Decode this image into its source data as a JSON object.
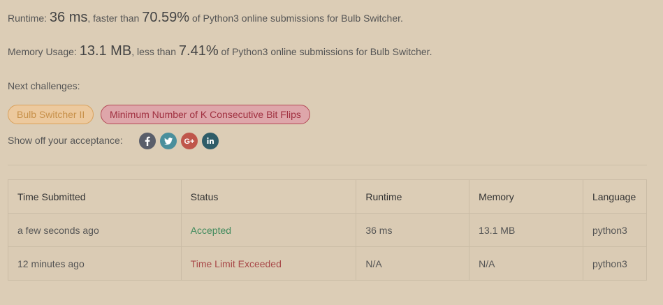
{
  "runtime_stat": {
    "label": "Runtime:",
    "value": "36 ms",
    "mid_text": ", faster than",
    "percent": "70.59%",
    "suffix": "of Python3 online submissions for Bulb Switcher."
  },
  "memory_stat": {
    "label": "Memory Usage:",
    "value": "13.1 MB",
    "mid_text": ", less than",
    "percent": "7.41%",
    "suffix": "of Python3 online submissions for Bulb Switcher."
  },
  "next_challenges": {
    "label": "Next challenges:",
    "items": [
      {
        "title": "Bulb Switcher II",
        "difficulty": "medium",
        "color": "#c79049"
      },
      {
        "title": "Minimum Number of K Consecutive Bit Flips",
        "difficulty": "hard",
        "color": "#a03040"
      }
    ]
  },
  "share": {
    "label": "Show off your acceptance:",
    "icons": [
      "facebook-icon",
      "twitter-icon",
      "google-plus-icon",
      "linkedin-icon"
    ]
  },
  "submissions_table": {
    "headers": [
      "Time Submitted",
      "Status",
      "Runtime",
      "Memory",
      "Language"
    ],
    "rows": [
      {
        "time": "a few seconds ago",
        "status": "Accepted",
        "runtime": "36 ms",
        "memory": "13.1 MB",
        "language": "python3",
        "status_color": "#3f8a5c"
      },
      {
        "time": "12 minutes ago",
        "status": "Time Limit Exceeded",
        "runtime": "N/A",
        "memory": "N/A",
        "language": "python3",
        "status_color": "#a84848"
      }
    ]
  }
}
